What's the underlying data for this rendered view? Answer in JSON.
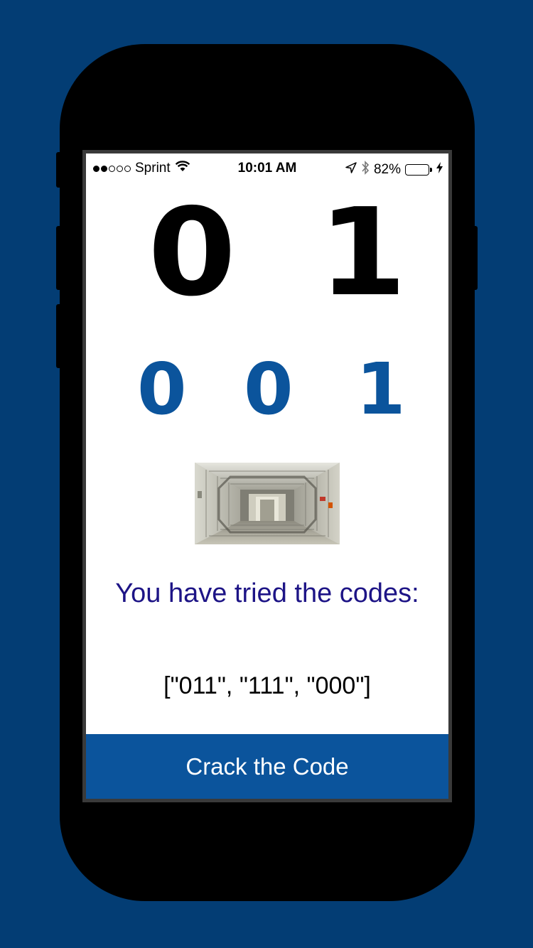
{
  "status_bar": {
    "carrier": "Sprint",
    "time": "10:01 AM",
    "battery_percent": "82%",
    "battery_level": 0.82,
    "signal_bars_filled": 2,
    "signal_bars_total": 5,
    "icons": [
      "wifi-icon",
      "location-arrow-icon",
      "bluetooth-icon",
      "battery-icon",
      "charging-bolt-icon"
    ]
  },
  "code_display": {
    "top_digits": [
      "0",
      "1"
    ],
    "guess_digits": [
      "0",
      "0",
      "1"
    ]
  },
  "image": {
    "name": "spaceship-corridor-image"
  },
  "tried": {
    "label": "You have tried the codes:",
    "codes": "[\"011\", \"111\", \"000\"]"
  },
  "action": {
    "crack_label": "Crack the Code"
  },
  "colors": {
    "background": "#033d74",
    "accent_blue": "#0b549c",
    "label_indigo": "#1d1486",
    "battery_green": "#2ecc40"
  }
}
